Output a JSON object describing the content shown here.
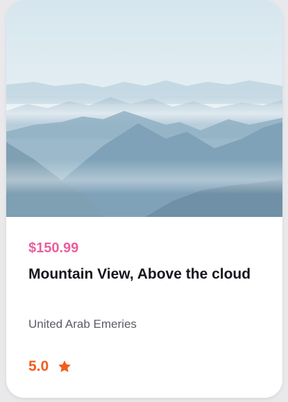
{
  "card": {
    "image": {
      "icon": "mountain-landscape-photo"
    },
    "price": "$150.99",
    "title": "Mountain View, Above the cloud",
    "location": "United Arab Emeries",
    "rating": {
      "value": "5.0",
      "icon": "star-icon"
    }
  },
  "colors": {
    "price": "#ec5d9f",
    "rating": "#f25d1c",
    "title": "#16161d",
    "location": "#5b5b66"
  }
}
